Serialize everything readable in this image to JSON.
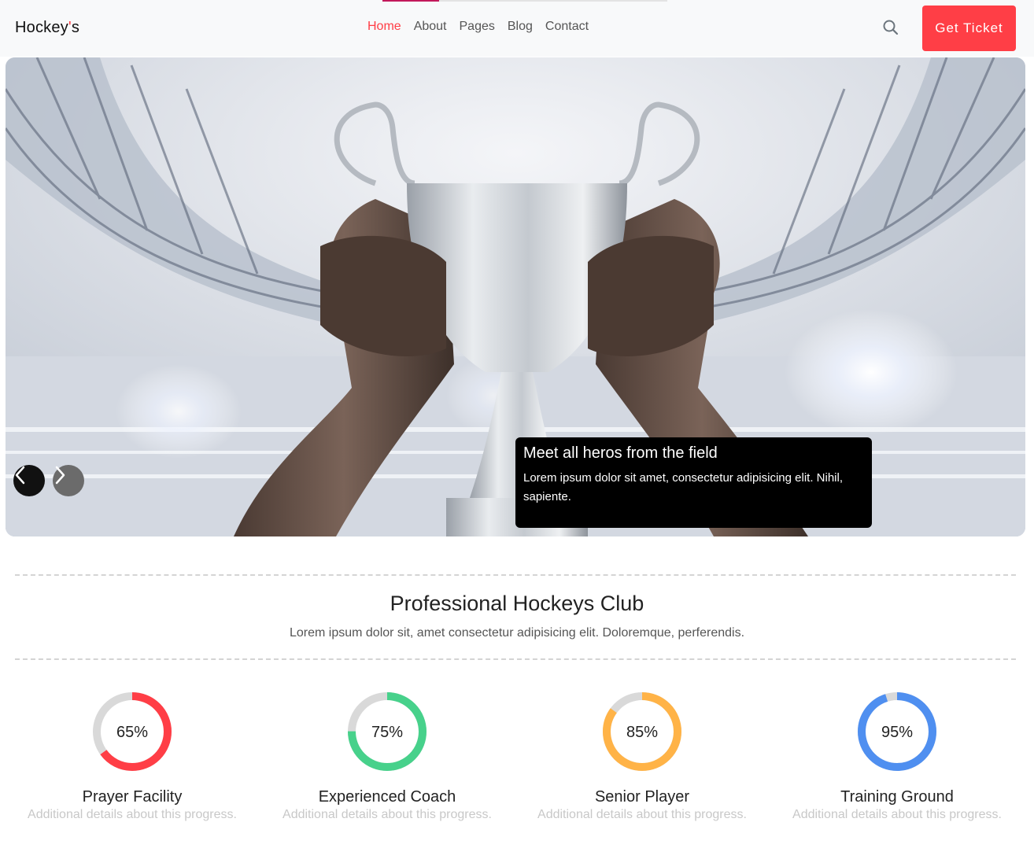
{
  "header": {
    "brand": "Hockey",
    "brand_apostrophe": "'",
    "brand_suffix": "s",
    "nav": [
      {
        "label": "Home",
        "active": true
      },
      {
        "label": "About"
      },
      {
        "label": "Pages"
      },
      {
        "label": "Blog"
      },
      {
        "label": "Contact"
      }
    ],
    "cta_label": "Get Ticket",
    "accent_color": "#ff3e46"
  },
  "hero": {
    "caption_title": "Meet all heros from the field",
    "caption_text": "Lorem ipsum dolor sit amet, consectetur adipisicing elit. Nihil, sapiente."
  },
  "section": {
    "title": "Professional Hockeys Club",
    "subtitle": "Lorem ipsum dolor sit, amet consectetur adipisicing elit. Doloremque, perferendis."
  },
  "progress": [
    {
      "percent_label": "65%",
      "value": 0.65,
      "color": "#ff3e46",
      "name": "Prayer Facility",
      "detail": "Additional details about this progress."
    },
    {
      "percent_label": "75%",
      "value": 0.75,
      "color": "#47d18b",
      "name": "Experienced Coach",
      "detail": "Additional details about this progress."
    },
    {
      "percent_label": "85%",
      "value": 0.85,
      "color": "#ffb347",
      "name": "Senior Player",
      "detail": "Additional details about this progress."
    },
    {
      "percent_label": "95%",
      "value": 0.95,
      "color": "#4f8ff0",
      "name": "Training Ground",
      "detail": "Additional details about this progress."
    }
  ]
}
